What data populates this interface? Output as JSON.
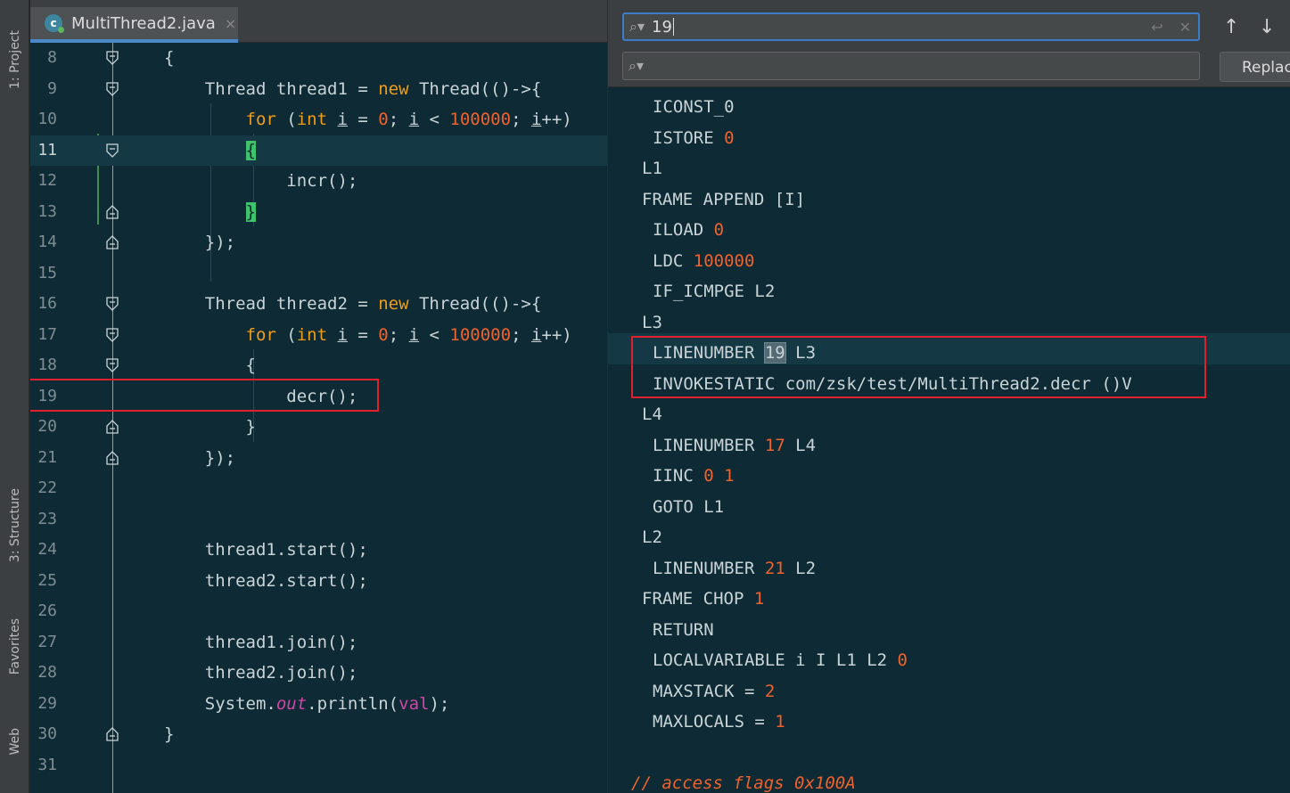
{
  "tool_strip": {
    "project_label": "1: Project",
    "structure_label": "3: Structure",
    "favorites_label": "Favorites",
    "web_label": "Web"
  },
  "editor": {
    "tab_icon_letter": "c",
    "tab_name": "MultiThread2.java",
    "tab_close": "×",
    "current_line": 11,
    "highlighted_line": 19
  },
  "find": {
    "search_value": "19",
    "replace_value": "",
    "replace_button": "Replace",
    "prev_icon": "↑",
    "next_icon": "↓",
    "search_icon": "search-icon"
  },
  "colors": {
    "background": "#0d2a35",
    "keyword": "#f09d1b",
    "number": "#f0622c",
    "field": "#d145a5",
    "box": "#e0202c",
    "brace_match": "#3ec26b"
  }
}
